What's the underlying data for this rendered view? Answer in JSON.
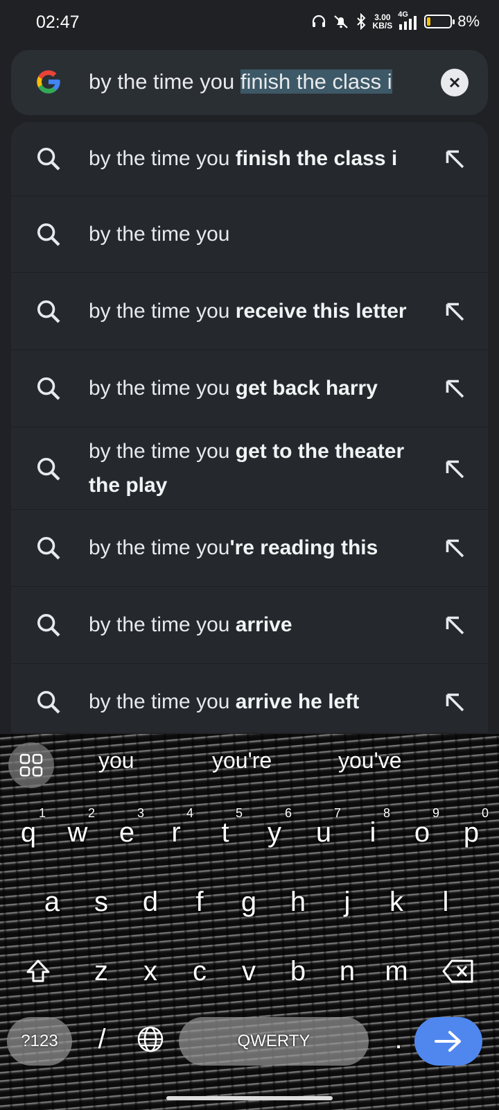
{
  "status_bar": {
    "time": "02:47",
    "net_speed_value": "3.00",
    "net_speed_unit": "KB/S",
    "network_type": "4G",
    "battery_percent": "8%",
    "battery_level": 0.08
  },
  "search": {
    "query_prefix": "by the time you ",
    "query_selected": "finish the class i"
  },
  "suggestions": [
    {
      "normal": "by the time you ",
      "bold": "finish the class i",
      "has_fill": true
    },
    {
      "normal": "by the time you",
      "bold": "",
      "has_fill": false
    },
    {
      "normal": "by the time you ",
      "bold": "receive this letter",
      "has_fill": true
    },
    {
      "normal": "by the time you ",
      "bold": "get back harry",
      "has_fill": true
    },
    {
      "normal": "by the time you ",
      "bold": "get to the theater the play",
      "has_fill": true
    },
    {
      "normal": "by the time you",
      "bold": "'re reading this",
      "has_fill": true
    },
    {
      "normal": "by the time you ",
      "bold": "arrive",
      "has_fill": true
    },
    {
      "normal": "by the time you ",
      "bold": "arrive he left",
      "has_fill": true
    }
  ],
  "keyboard": {
    "predictions": [
      "you",
      "you're",
      "you've"
    ],
    "row1": [
      {
        "k": "q",
        "n": "1"
      },
      {
        "k": "w",
        "n": "2"
      },
      {
        "k": "e",
        "n": "3"
      },
      {
        "k": "r",
        "n": "4"
      },
      {
        "k": "t",
        "n": "5"
      },
      {
        "k": "y",
        "n": "6"
      },
      {
        "k": "u",
        "n": "7"
      },
      {
        "k": "i",
        "n": "8"
      },
      {
        "k": "o",
        "n": "9"
      },
      {
        "k": "p",
        "n": "0"
      }
    ],
    "row2": [
      "a",
      "s",
      "d",
      "f",
      "g",
      "h",
      "j",
      "k",
      "l"
    ],
    "row3": [
      "z",
      "x",
      "c",
      "v",
      "b",
      "n",
      "m"
    ],
    "symbols_label": "?123",
    "slash_label": "/",
    "space_label": "QWERTY",
    "period_label": "."
  }
}
